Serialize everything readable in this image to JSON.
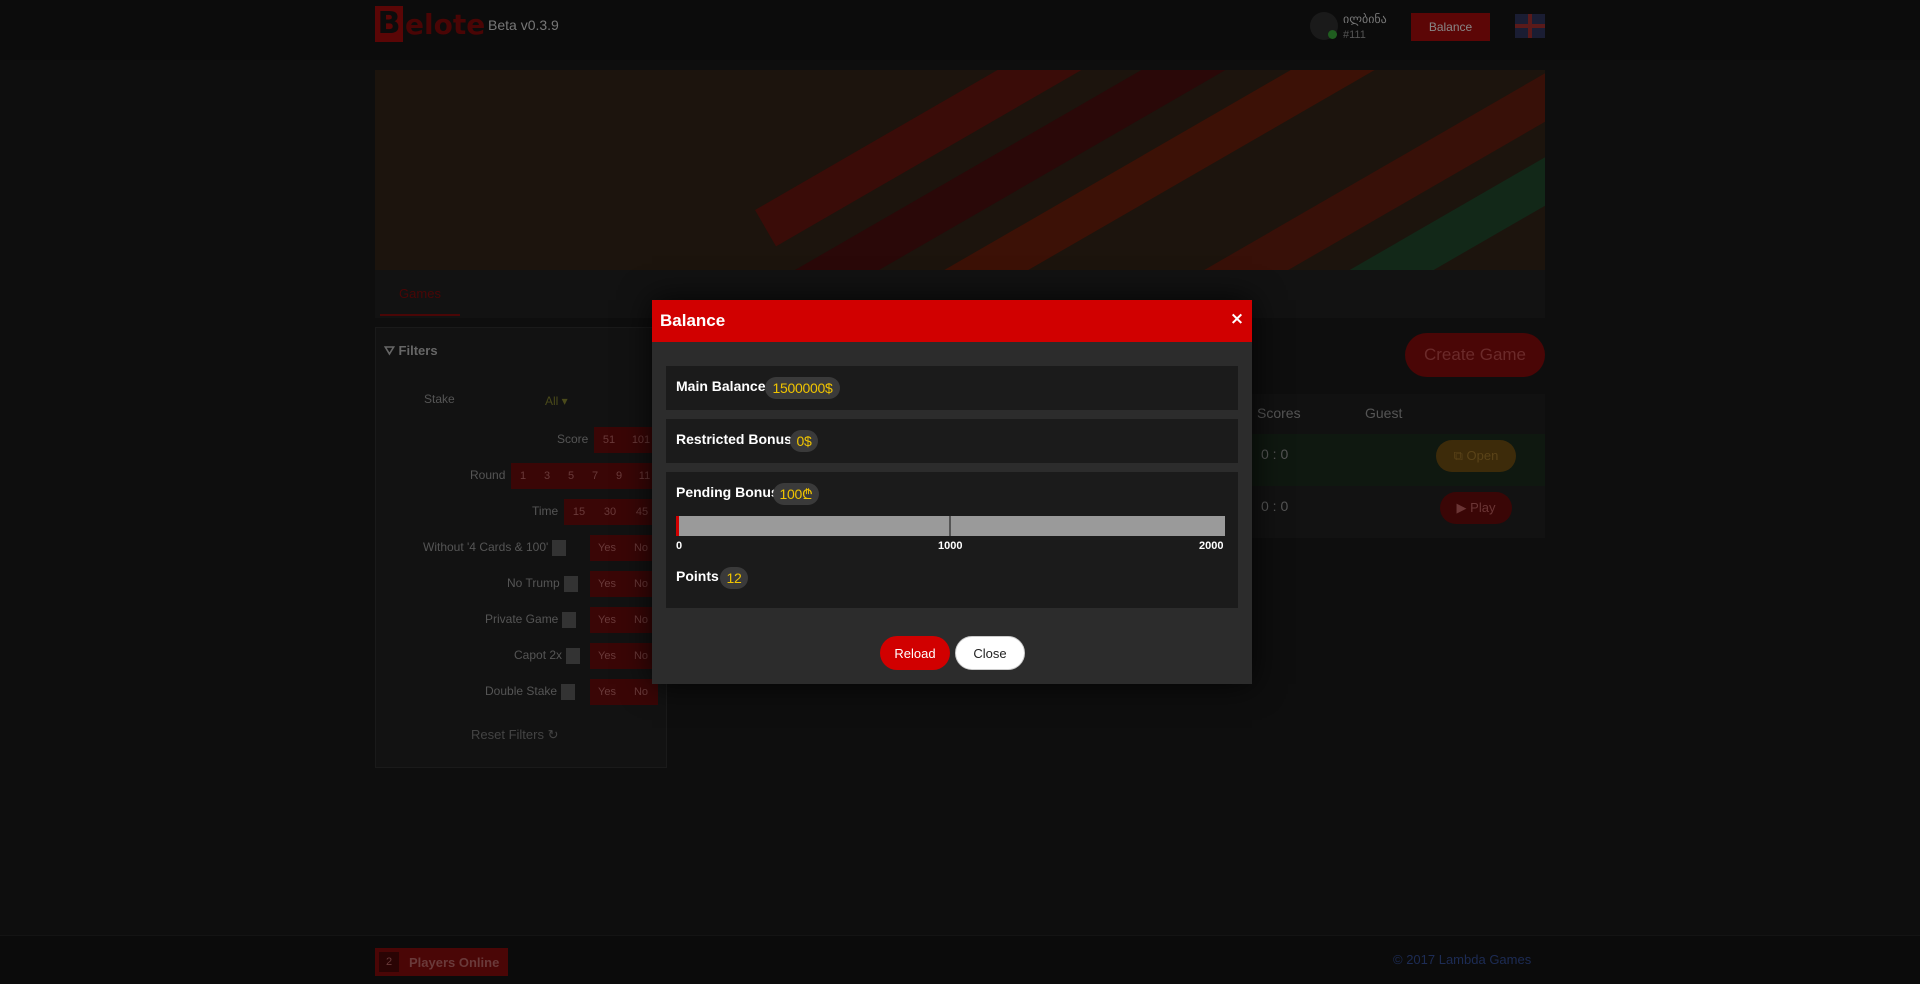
{
  "header": {
    "logo_letter": "B",
    "logo_text": "elote",
    "version": "Beta v0.3.9",
    "user_name": "ილბინა",
    "user_id": "#111",
    "balance_button": "Balance",
    "language_flag": "uk-flag-icon"
  },
  "tabs": {
    "active_label": "Games"
  },
  "filters": {
    "title": "Filters",
    "stake_label": "Stake",
    "stake_value": "All",
    "score_label": "Score",
    "score_options": [
      "51",
      "101"
    ],
    "round_label": "Round",
    "round_options": [
      "1",
      "3",
      "5",
      "7",
      "9",
      "11"
    ],
    "time_label": "Time",
    "time_options": [
      "15",
      "30",
      "45"
    ],
    "without_label": "Without '4 Cards & 100'",
    "notrump_label": "No Trump",
    "private_label": "Private Game",
    "capot_label": "Capot 2x",
    "double_label": "Double Stake",
    "yes": "Yes",
    "no": "No",
    "reset_label": "Reset Filters"
  },
  "games": {
    "create_button": "Create Game",
    "columns": {
      "scores": "Scores",
      "guest": "Guest"
    },
    "rows": [
      {
        "score": "0 : 0",
        "action": "Open"
      },
      {
        "score": "0 : 0",
        "action": "Play"
      }
    ]
  },
  "footer": {
    "players_count": "2",
    "players_label": "Players Online",
    "copyright": "© 2017 Lambda Games"
  },
  "modal": {
    "title": "Balance",
    "close_icon": "×",
    "main_balance_label": "Main Balance",
    "main_balance_value": "1500000$",
    "restricted_bonus_label": "Restricted Bonus",
    "restricted_bonus_value": "0$",
    "pending_bonus_label": "Pending Bonus",
    "pending_bonus_value": "100₾",
    "progress": {
      "value": 12,
      "max": 2000,
      "ticks": [
        "0",
        "1000",
        "2000"
      ]
    },
    "points_label": "Points",
    "points_value": "12",
    "reload_button": "Reload",
    "close_button": "Close",
    "accent_color": "#d10000",
    "value_color": "#f0c400"
  }
}
